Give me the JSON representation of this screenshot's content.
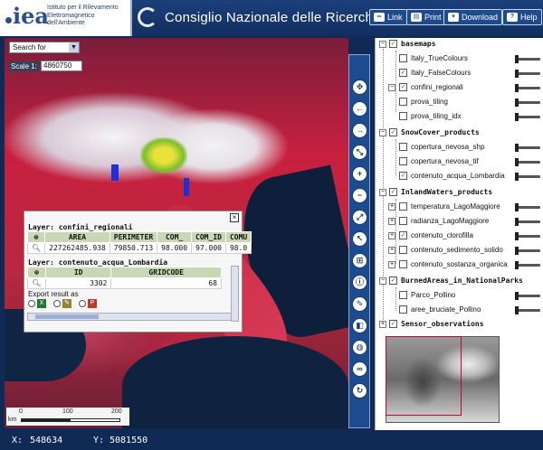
{
  "header": {
    "logo_mark": "i",
    "logo_lines": [
      "Istituto per il Rilevamento",
      "Elettromagnetico",
      "dell'Ambiente"
    ],
    "title": "Consiglio Nazionale delle Ricerche",
    "buttons": {
      "link": "Link",
      "print": "Print",
      "download": "Download",
      "help": "Help"
    }
  },
  "map": {
    "search_for": "Search for",
    "scale_label": "Scale 1:",
    "scale_value": "4860750",
    "scalebar": {
      "unit": "km",
      "ticks": [
        "0",
        "100",
        "200"
      ]
    }
  },
  "popup": {
    "layer1": {
      "title": "Layer: confini_regionali",
      "headers": [
        "AREA",
        "PERIMETER",
        "COM_",
        "COM_ID",
        "COMU"
      ],
      "row": [
        "227262485.938",
        "79850.713",
        "98.000",
        "97.000",
        "98.0"
      ]
    },
    "layer2": {
      "title": "Layer: contenuto_acqua_Lombardia",
      "headers": [
        "ID",
        "GRIDCODE"
      ],
      "row": [
        "3302",
        "68"
      ]
    },
    "export_label": "Export result as"
  },
  "tree": {
    "groups": [
      {
        "name": "basemaps",
        "items": [
          {
            "label": "Italy_TrueColours",
            "checked": false
          },
          {
            "label": "Italy_FalseColours",
            "checked": true
          },
          {
            "label": "confini_regionali",
            "checked": true
          },
          {
            "label": "prova_tiling",
            "checked": false
          },
          {
            "label": "prova_tiling_idx",
            "checked": false
          }
        ]
      },
      {
        "name": "SnowCover_products",
        "items": [
          {
            "label": "copertura_nevosa_shp",
            "checked": false
          },
          {
            "label": "copertura_nevosa_tif",
            "checked": false
          },
          {
            "label": "contenuto_acqua_Lombardia",
            "checked": true
          }
        ]
      },
      {
        "name": "InlandWaters_products",
        "items": [
          {
            "label": "temperatura_LagoMaggiore",
            "checked": false
          },
          {
            "label": "radianza_LagoMaggiore",
            "checked": false
          },
          {
            "label": "contenuto_clorofilla",
            "checked": true
          },
          {
            "label": "contenuto_sedimento_solido",
            "checked": false
          },
          {
            "label": "contenuto_sostanza_organica",
            "checked": false
          }
        ]
      },
      {
        "name": "BurnedAreas_in_NationalParks",
        "items": [
          {
            "label": "Parco_Pollino",
            "checked": false
          },
          {
            "label": "aree_bruciate_Pollino",
            "checked": false
          }
        ]
      },
      {
        "name": "Sensor_observations",
        "items": []
      }
    ]
  },
  "status": {
    "x_label": "X:",
    "x_value": "548634",
    "y_label": "Y:",
    "y_value": "5081550"
  },
  "icons": {
    "export_xls": "X",
    "export_csv": "✎",
    "export_pdf": "P"
  }
}
